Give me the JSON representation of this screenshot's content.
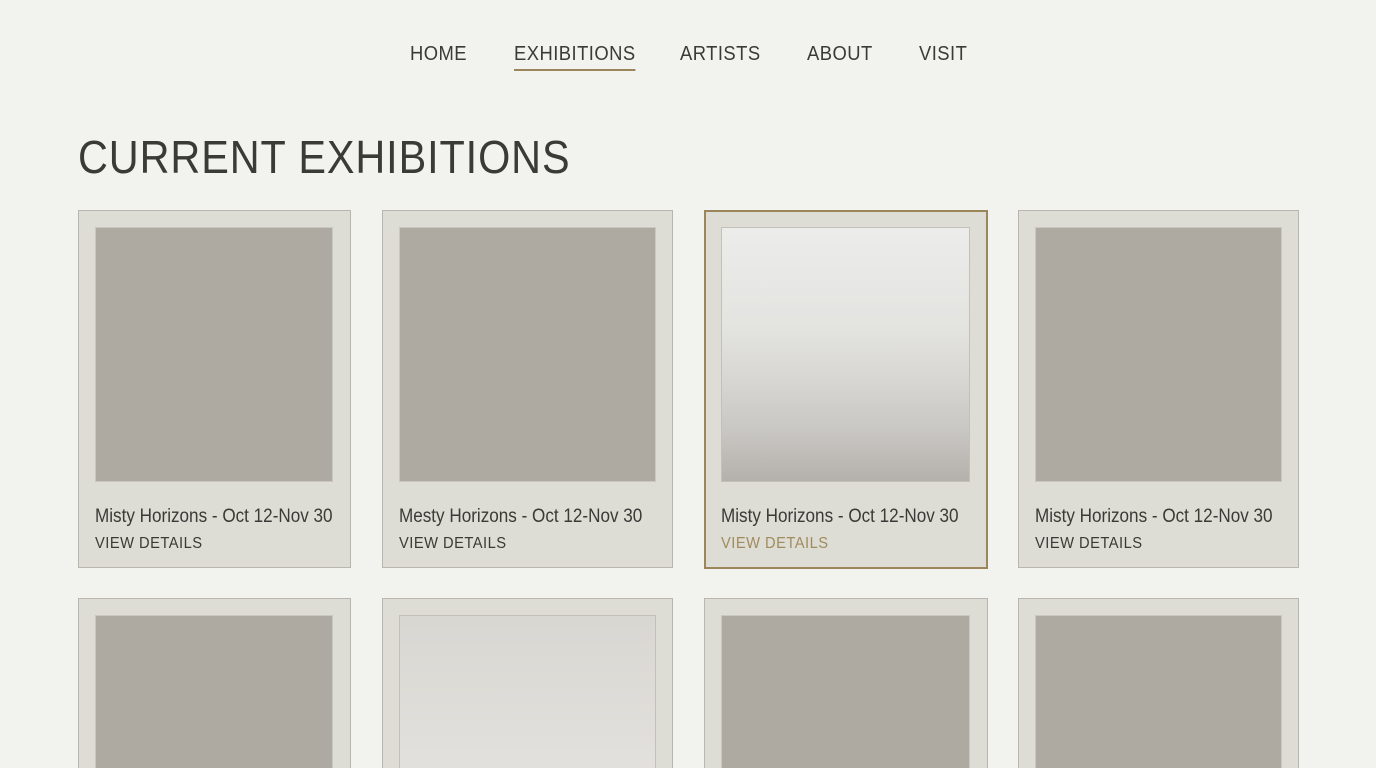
{
  "nav": {
    "items": [
      {
        "label": "HOME",
        "active": false
      },
      {
        "label": "EXHIBITIONS",
        "active": true
      },
      {
        "label": "ARTISTS",
        "active": false
      },
      {
        "label": "ABOUT",
        "active": false
      },
      {
        "label": "VISIT",
        "active": false
      }
    ]
  },
  "main": {
    "title": "CURRENT EXHIBITIONS",
    "cards": [
      {
        "title": "Misty Horizons - Oct 12-Nov 30",
        "link": "VIEW DETAILS",
        "image": "placeholder",
        "selected": false
      },
      {
        "title": "Mesty Horizons - Oct 12-Nov 30",
        "link": "VIEW DETAILS",
        "image": "placeholder",
        "selected": false
      },
      {
        "title": "Misty Horizons - Oct 12-Nov 30",
        "link": "VIEW DETAILS",
        "image": "misty-seascape",
        "selected": true
      },
      {
        "title": "Misty Horizons - Oct 12-Nov 30",
        "link": "VIEW DETAILS",
        "image": "placeholder",
        "selected": false
      },
      {
        "image": "placeholder"
      },
      {
        "image": "pale-seascape"
      },
      {
        "image": "placeholder"
      },
      {
        "image": "placeholder"
      }
    ]
  },
  "colors": {
    "background": "#f2f2ee",
    "card": "#dddcd5",
    "placeholder": "#aeaaa2",
    "accent": "#9a865a",
    "text": "#3a3a36"
  }
}
